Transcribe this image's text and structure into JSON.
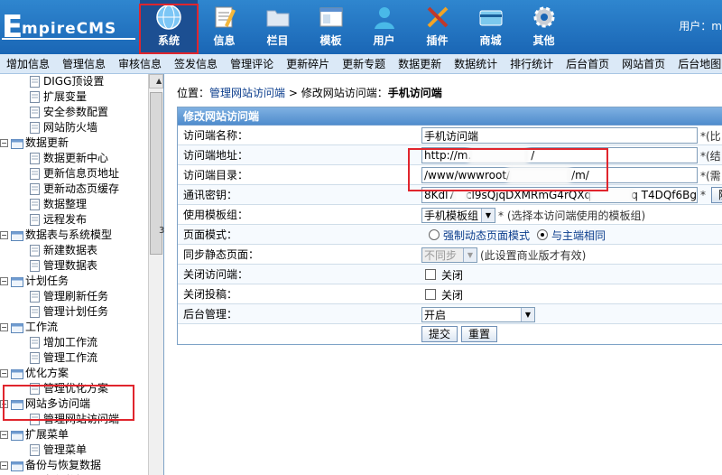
{
  "logo": {
    "big": "E",
    "rest": "mpireCMS"
  },
  "top_nav": [
    {
      "label": "系统",
      "icon": "globe-icon",
      "active": true
    },
    {
      "label": "信息",
      "icon": "notepad-icon"
    },
    {
      "label": "栏目",
      "icon": "folder-icon"
    },
    {
      "label": "模板",
      "icon": "window-icon"
    },
    {
      "label": "用户",
      "icon": "user-icon"
    },
    {
      "label": "插件",
      "icon": "tools-icon"
    },
    {
      "label": "商城",
      "icon": "card-icon"
    },
    {
      "label": "其他",
      "icon": "gear-icon"
    }
  ],
  "user_info": "用户：m",
  "menu": [
    "增加信息",
    "管理信息",
    "审核信息",
    "签发信息",
    "管理评论",
    "更新碎片",
    "更新专题",
    "数据更新",
    "数据统计",
    "排行统计",
    "后台首页",
    "网站首页",
    "后台地图"
  ],
  "sidebar": {
    "rows": [
      {
        "type": "leaf",
        "label": "DIGG顶设置"
      },
      {
        "type": "leaf",
        "label": "扩展变量"
      },
      {
        "type": "leaf",
        "label": "安全参数配置"
      },
      {
        "type": "leaf",
        "label": "网站防火墙"
      },
      {
        "type": "group",
        "label": "数据更新"
      },
      {
        "type": "leaf",
        "label": "数据更新中心"
      },
      {
        "type": "leaf",
        "label": "更新信息页地址"
      },
      {
        "type": "leaf",
        "label": "更新动态页缓存"
      },
      {
        "type": "leaf",
        "label": "数据整理"
      },
      {
        "type": "leaf",
        "label": "远程发布"
      },
      {
        "type": "group",
        "label": "数据表与系统模型"
      },
      {
        "type": "leaf",
        "label": "新建数据表"
      },
      {
        "type": "leaf",
        "label": "管理数据表"
      },
      {
        "type": "group",
        "label": "计划任务"
      },
      {
        "type": "leaf",
        "label": "管理刷新任务"
      },
      {
        "type": "leaf",
        "label": "管理计划任务"
      },
      {
        "type": "group",
        "label": "工作流"
      },
      {
        "type": "leaf",
        "label": "增加工作流"
      },
      {
        "type": "leaf",
        "label": "管理工作流"
      },
      {
        "type": "group",
        "label": "优化方案"
      },
      {
        "type": "leaf",
        "label": "管理优化方案"
      },
      {
        "type": "group",
        "label": "网站多访问端"
      },
      {
        "type": "leaf",
        "label": "管理网站访问端"
      },
      {
        "type": "group",
        "label": "扩展菜单"
      },
      {
        "type": "leaf",
        "label": "管理菜单"
      },
      {
        "type": "group",
        "label": "备份与恢复数据"
      },
      {
        "type": "leaf",
        "label": "备份数据"
      }
    ],
    "splitter_text": "3"
  },
  "breadcrumb": {
    "prefix": "位置：",
    "link": "管理网站访问端",
    "sep": " > 修改网站访问端：",
    "current": "手机访问端"
  },
  "form": {
    "title": "修改网站访问端",
    "name_label": "访问端名称：",
    "name_value": "手机访问端",
    "name_hint": "*(比",
    "url_label": "访问端地址：",
    "url_value": "http://m.",
    "url_tail": "/",
    "url_hint": "*(结",
    "dir_label": "访问端目录：",
    "dir_value": "/www/wwwroot/",
    "dir_tail": "/m/",
    "dir_hint": "*(需",
    "key_label": "通讯密钥：",
    "key_value": "8Kdl7",
    "key_mid": "cl9sQjqDXMRmG4rQXq",
    "key_end": "q T4DQf6Bg",
    "key_hint": "*",
    "key_btn": "随",
    "tpl_label": "使用模板组：",
    "tpl_value": "手机模板组",
    "tpl_hint": "* (选择本访问端使用的模板组)",
    "mode_label": "页面模式：",
    "mode_opt1": "强制动态页面模式",
    "mode_opt2": "与主端相同",
    "sync_label": "同步静态页面：",
    "sync_value": "不同步",
    "sync_hint": "(此设置商业版才有效)",
    "close_label": "关闭访问端：",
    "close_text": "关闭",
    "submit_close_label": "关闭投稿：",
    "submit_close_text": "关闭",
    "admin_label": "后台管理：",
    "admin_value": "开启",
    "submit_btn": "提交",
    "reset_btn": "重置"
  }
}
